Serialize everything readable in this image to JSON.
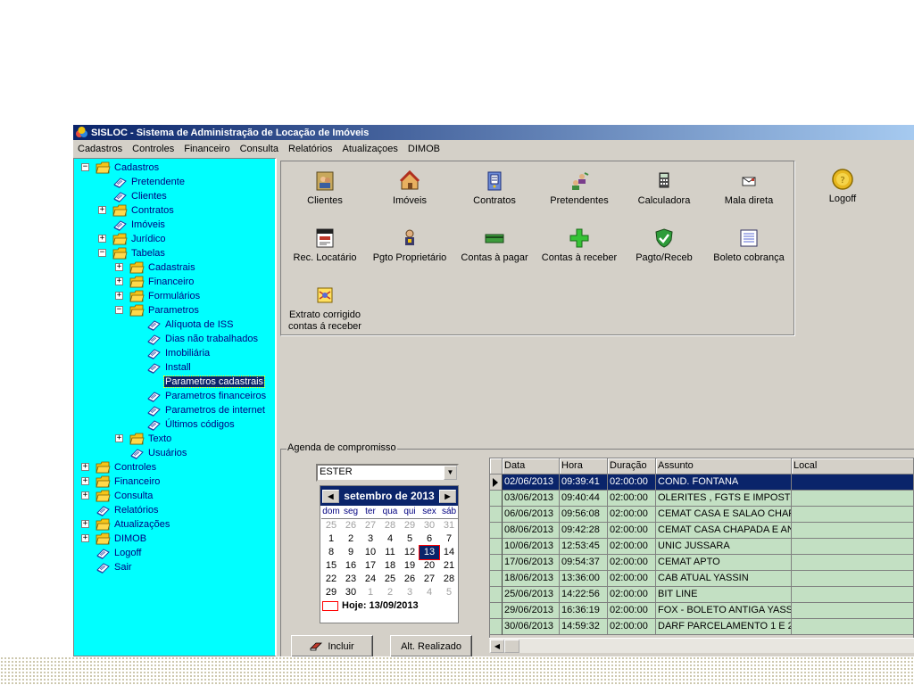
{
  "window": {
    "title": "SISLOC - Sistema de Administração de Locação de Imóveis"
  },
  "menu": [
    "Cadastros",
    "Controles",
    "Financeiro",
    "Consulta",
    "Relatórios",
    "Atualizaçoes",
    "DIMOB"
  ],
  "tree": [
    {
      "label": "Cadastros",
      "level": 0,
      "expander": "−",
      "icon": "folder"
    },
    {
      "label": "Pretendente",
      "level": 1,
      "expander": "",
      "icon": "book"
    },
    {
      "label": "Clientes",
      "level": 1,
      "expander": "",
      "icon": "book"
    },
    {
      "label": "Contratos",
      "level": 1,
      "expander": "+",
      "icon": "folder"
    },
    {
      "label": "Imóveis",
      "level": 1,
      "expander": "",
      "icon": "book"
    },
    {
      "label": "Jurídico",
      "level": 1,
      "expander": "+",
      "icon": "folder"
    },
    {
      "label": "Tabelas",
      "level": 1,
      "expander": "−",
      "icon": "folder"
    },
    {
      "label": "Cadastrais",
      "level": 2,
      "expander": "+",
      "icon": "folder"
    },
    {
      "label": "Financeiro",
      "level": 2,
      "expander": "+",
      "icon": "folder"
    },
    {
      "label": "Formulários",
      "level": 2,
      "expander": "+",
      "icon": "folder"
    },
    {
      "label": "Parametros",
      "level": 2,
      "expander": "−",
      "icon": "folder"
    },
    {
      "label": "Alíquota de ISS",
      "level": 3,
      "expander": "",
      "icon": "book"
    },
    {
      "label": "Dias não trabalhados",
      "level": 3,
      "expander": "",
      "icon": "book"
    },
    {
      "label": "Imobiliária",
      "level": 3,
      "expander": "",
      "icon": "book"
    },
    {
      "label": "Install",
      "level": 3,
      "expander": "",
      "icon": "book"
    },
    {
      "label": "Parametros cadastrais",
      "level": 3,
      "expander": "",
      "icon": "none",
      "selected": true
    },
    {
      "label": "Parametros financeiros",
      "level": 3,
      "expander": "",
      "icon": "book"
    },
    {
      "label": "Parametros de internet",
      "level": 3,
      "expander": "",
      "icon": "book"
    },
    {
      "label": "Últimos códigos",
      "level": 3,
      "expander": "",
      "icon": "book"
    },
    {
      "label": "Texto",
      "level": 2,
      "expander": "+",
      "icon": "folder"
    },
    {
      "label": "Usuários",
      "level": 2,
      "expander": "",
      "icon": "book"
    },
    {
      "label": "Controles",
      "level": 0,
      "expander": "+",
      "icon": "folder"
    },
    {
      "label": "Financeiro",
      "level": 0,
      "expander": "+",
      "icon": "folder"
    },
    {
      "label": "Consulta",
      "level": 0,
      "expander": "+",
      "icon": "folder"
    },
    {
      "label": "Relatórios",
      "level": 0,
      "expander": "",
      "icon": "book"
    },
    {
      "label": "Atualizações",
      "level": 0,
      "expander": "+",
      "icon": "folder"
    },
    {
      "label": "DIMOB",
      "level": 0,
      "expander": "+",
      "icon": "folder"
    },
    {
      "label": "Logoff",
      "level": 0,
      "expander": "",
      "icon": "book"
    },
    {
      "label": "Sair",
      "level": 0,
      "expander": "",
      "icon": "book"
    }
  ],
  "toolbar": [
    {
      "label": "Clientes",
      "icon": "clients-icon"
    },
    {
      "label": "Imóveis",
      "icon": "house-icon"
    },
    {
      "label": "Contratos",
      "icon": "contract-icon"
    },
    {
      "label": "Pretendentes",
      "icon": "people-icon"
    },
    {
      "label": "Calculadora",
      "icon": "calculator-icon"
    },
    {
      "label": "Mala direta",
      "icon": "mail-icon"
    },
    {
      "label": "Rec. Locatário",
      "icon": "receipt-icon"
    },
    {
      "label": "Pgto Proprietário",
      "icon": "owner-icon"
    },
    {
      "label": "Contas à pagar",
      "icon": "money-icon"
    },
    {
      "label": "Contas à receber",
      "icon": "plus-icon"
    },
    {
      "label": "Pagto/Receb",
      "icon": "shield-check-icon"
    },
    {
      "label": "Boleto cobrança",
      "icon": "list-icon"
    },
    {
      "label": "Extrato corrigido\ncontas á receber",
      "icon": "statement-icon"
    }
  ],
  "logoff": {
    "label": "Logoff",
    "icon": "logoff-icon"
  },
  "agenda": {
    "legend": "Agenda de compromisso",
    "user": "ESTER",
    "calendar": {
      "month_label": "setembro de 2013",
      "weekdays": [
        "dom",
        "seg",
        "ter",
        "qua",
        "qui",
        "sex",
        "sáb"
      ],
      "days": [
        {
          "d": "25",
          "other": true
        },
        {
          "d": "26",
          "other": true
        },
        {
          "d": "27",
          "other": true
        },
        {
          "d": "28",
          "other": true
        },
        {
          "d": "29",
          "other": true
        },
        {
          "d": "30",
          "other": true
        },
        {
          "d": "31",
          "other": true
        },
        {
          "d": "1"
        },
        {
          "d": "2"
        },
        {
          "d": "3"
        },
        {
          "d": "4"
        },
        {
          "d": "5"
        },
        {
          "d": "6"
        },
        {
          "d": "7"
        },
        {
          "d": "8"
        },
        {
          "d": "9"
        },
        {
          "d": "10"
        },
        {
          "d": "11"
        },
        {
          "d": "12"
        },
        {
          "d": "13",
          "today": true
        },
        {
          "d": "14"
        },
        {
          "d": "15"
        },
        {
          "d": "16"
        },
        {
          "d": "17"
        },
        {
          "d": "18"
        },
        {
          "d": "19"
        },
        {
          "d": "20"
        },
        {
          "d": "21"
        },
        {
          "d": "22"
        },
        {
          "d": "23"
        },
        {
          "d": "24"
        },
        {
          "d": "25"
        },
        {
          "d": "26"
        },
        {
          "d": "27"
        },
        {
          "d": "28"
        },
        {
          "d": "29"
        },
        {
          "d": "30"
        },
        {
          "d": "1",
          "other": true
        },
        {
          "d": "2",
          "other": true
        },
        {
          "d": "3",
          "other": true
        },
        {
          "d": "4",
          "other": true
        },
        {
          "d": "5",
          "other": true
        }
      ],
      "today_label": "Hoje: 13/09/2013"
    },
    "buttons": {
      "include": "Incluir",
      "done": "Alt. Realizado"
    },
    "columns": [
      "Data",
      "Hora",
      "Duração",
      "Assunto",
      "Local"
    ],
    "rows": [
      {
        "data": "02/06/2013",
        "hora": "09:39:41",
        "duracao": "02:00:00",
        "assunto": "COND. FONTANA",
        "local": "",
        "selected": true
      },
      {
        "data": "03/06/2013",
        "hora": "09:40:44",
        "duracao": "02:00:00",
        "assunto": "OLERITES , FGTS E IMPOSTO",
        "local": ""
      },
      {
        "data": "06/06/2013",
        "hora": "09:56:08",
        "duracao": "02:00:00",
        "assunto": "CEMAT CASA E SALAO CHAP",
        "local": ""
      },
      {
        "data": "08/06/2013",
        "hora": "09:42:28",
        "duracao": "02:00:00",
        "assunto": "CEMAT CASA CHAPADA E AN",
        "local": ""
      },
      {
        "data": "10/06/2013",
        "hora": "12:53:45",
        "duracao": "02:00:00",
        "assunto": "UNIC JUSSARA",
        "local": ""
      },
      {
        "data": "17/06/2013",
        "hora": "09:54:37",
        "duracao": "02:00:00",
        "assunto": "CEMAT APTO",
        "local": ""
      },
      {
        "data": "18/06/2013",
        "hora": "13:36:00",
        "duracao": "02:00:00",
        "assunto": "CAB  ATUAL YASSIN",
        "local": ""
      },
      {
        "data": "25/06/2013",
        "hora": "14:22:56",
        "duracao": "02:00:00",
        "assunto": "BIT LINE",
        "local": ""
      },
      {
        "data": "29/06/2013",
        "hora": "16:36:19",
        "duracao": "02:00:00",
        "assunto": "FOX - BOLETO ANTIGA YASS",
        "local": ""
      },
      {
        "data": "30/06/2013",
        "hora": "14:59:32",
        "duracao": "02:00:00",
        "assunto": "DARF PARCELAMENTO 1 E 2",
        "local": ""
      }
    ]
  }
}
